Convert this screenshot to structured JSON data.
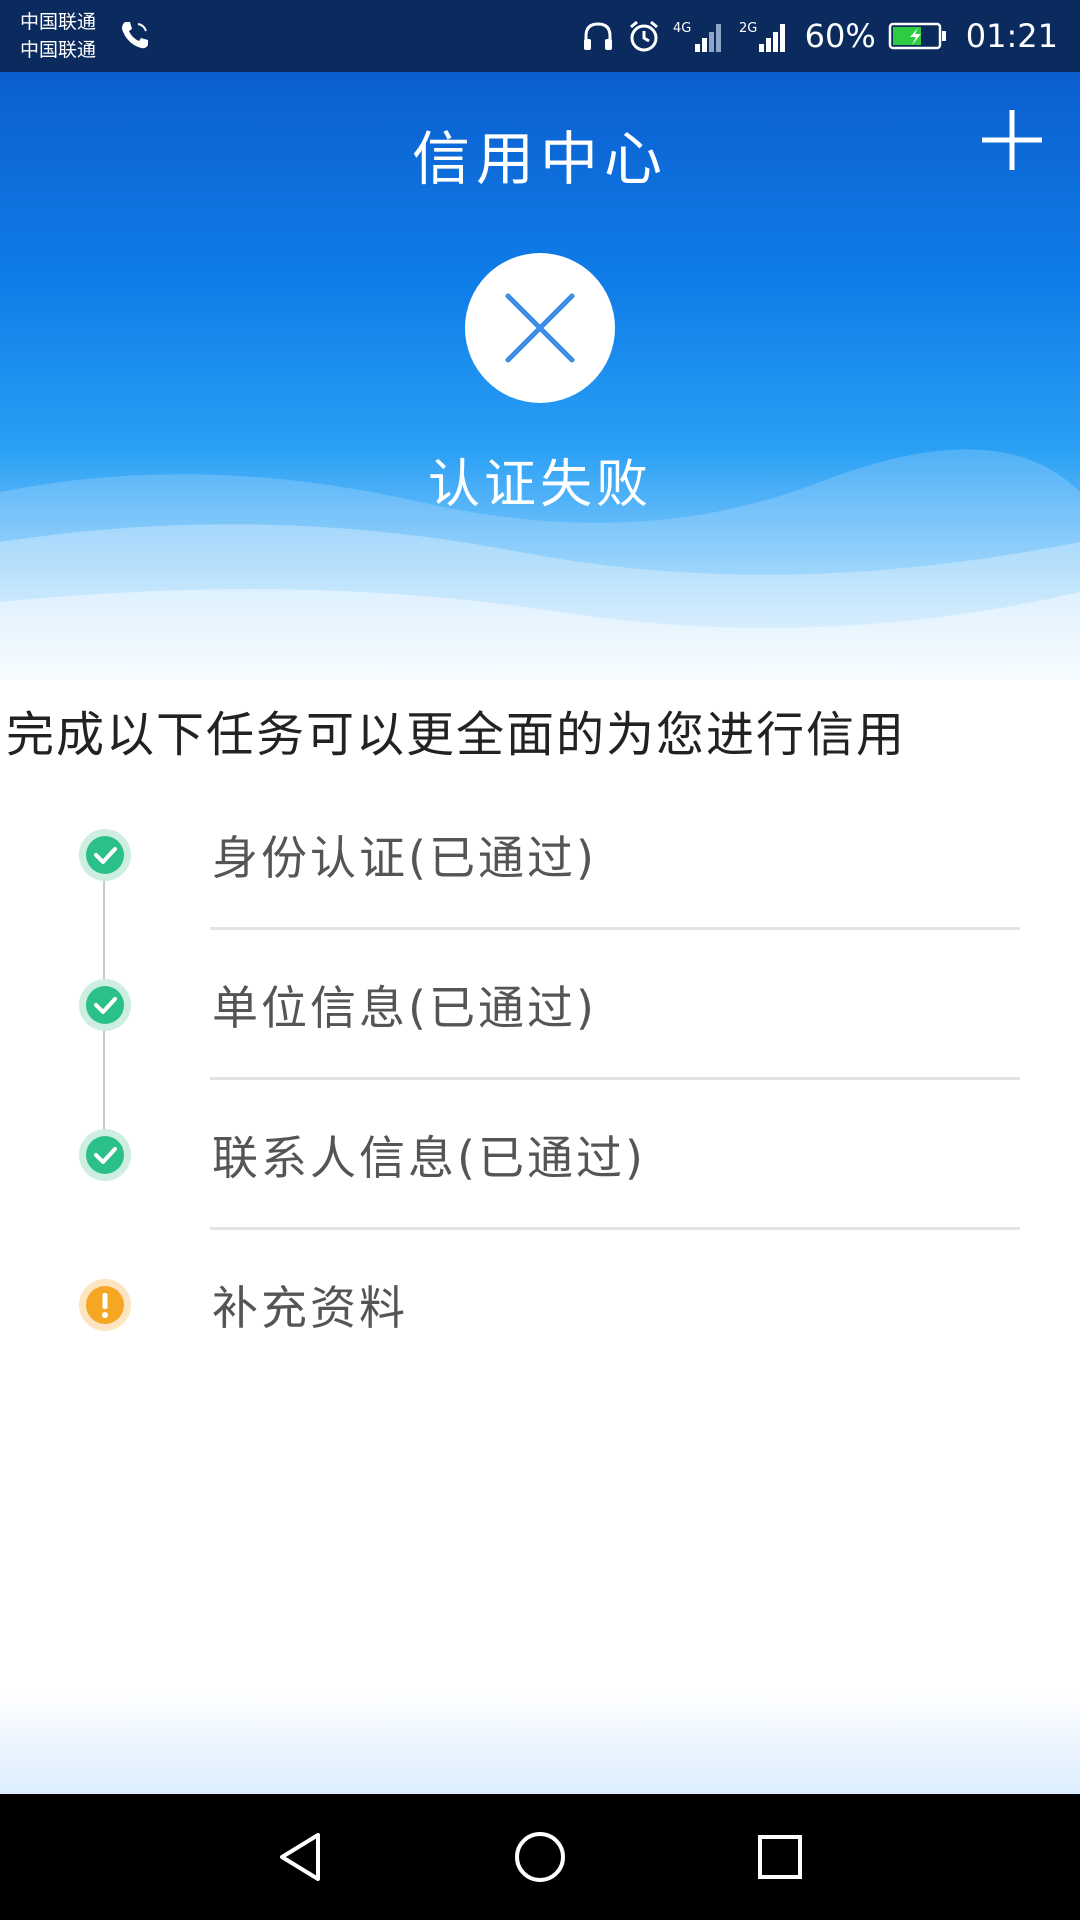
{
  "status_bar": {
    "carrier_1": "中国联通",
    "carrier_2": "中国联通",
    "signal_1_label": "4G",
    "signal_2_label": "2G",
    "battery": "60%",
    "time": "01:21"
  },
  "header": {
    "title": "信用中心",
    "add_icon": "plus-icon",
    "result_icon": "close-icon",
    "result_text": "认证失败"
  },
  "intro_text": "完成以下任务可以更全面的为您进行信用",
  "tasks": [
    {
      "label": "身份认证(已通过)",
      "icon": "check-circle-icon",
      "color": "#2bbf8a"
    },
    {
      "label": "单位信息(已通过)",
      "icon": "check-circle-icon",
      "color": "#2bbf8a"
    },
    {
      "label": "联系人信息(已通过)",
      "icon": "check-circle-icon",
      "color": "#2bbf8a"
    },
    {
      "label": "补充资料",
      "icon": "warning-circle-icon",
      "color": "#f5a623"
    }
  ],
  "nav": {
    "back_icon": "back-icon",
    "home_icon": "home-icon",
    "recents_icon": "recents-icon"
  },
  "colors": {
    "header_top": "#0b5fcf",
    "header_bottom": "#e9f6ff",
    "fail_icon": "#3a8ee6",
    "status_bar": "#0b2a5e"
  }
}
